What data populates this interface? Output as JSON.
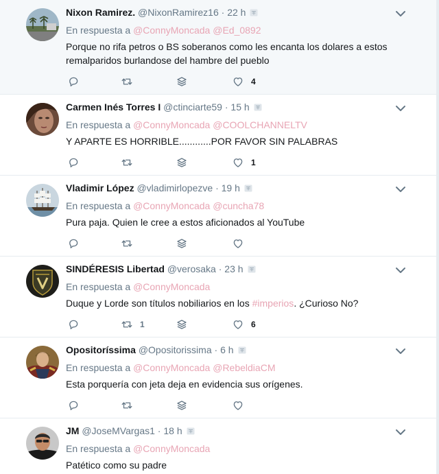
{
  "reply_prefix": "En respuesta a",
  "colors": {
    "mention": "#e8a5b4",
    "muted": "#657786",
    "text": "#14171a",
    "border": "#e6ecf0",
    "highlight": "#f5f8fa"
  },
  "tweets": [
    {
      "name": "Nixon Ramirez.",
      "handle": "@NixonRamirez16",
      "dot": "·",
      "time": "22 h",
      "mention1": "@ConnyMoncada",
      "mention2": "@Ed_0892",
      "text1": "Porque no rifa petros o BS soberanos  como les encanta los dolares a estos",
      "text2": "remalparidos burlandose del hambre del pueblo",
      "retweets": "",
      "likes": "4"
    },
    {
      "name": "Carmen Inés Torres I",
      "handle": "@ctinciarte59",
      "dot": "·",
      "time": "15 h",
      "mention1": "@ConnyMoncada",
      "mention2": "@COOLCHANNELTV",
      "text1": "Y APARTE ES HORRIBLE............POR FAVOR SIN PALABRAS",
      "retweets": "",
      "likes": "1"
    },
    {
      "name": "Vladimir López",
      "handle": "@vladimirlopezve",
      "dot": "·",
      "time": "19 h",
      "mention1": "@ConnyMoncada",
      "mention2": "@cuncha78",
      "text1": "Pura paja. Quien le cree a estos aficionados al YouTube",
      "retweets": "",
      "likes": ""
    },
    {
      "name": "SINDÉRESIS Libertad",
      "handle": "@verosaka",
      "dot": "·",
      "time": "23 h",
      "mention1": "@ConnyMoncada",
      "text_before": "Duque y Lorde son títulos nobiliarios en los ",
      "hashtag": "#imperios",
      "text_after": ". ¿Curioso No?",
      "retweets": "1",
      "likes": "6"
    },
    {
      "name": "Opositoríssima",
      "handle": "@Opositorissima",
      "dot": "·",
      "time": "6 h",
      "mention1": "@ConnyMoncada",
      "mention2": "@RebeldiaCM",
      "text1": "Esta porquería con jeta deja en evidencia sus orígenes.",
      "retweets": "",
      "likes": ""
    },
    {
      "name": "JM",
      "handle": "@JoseMVargas1",
      "dot": "·",
      "time": "18 h",
      "mention1": "@ConnyMoncada",
      "text1": "Patético como su padre"
    }
  ]
}
